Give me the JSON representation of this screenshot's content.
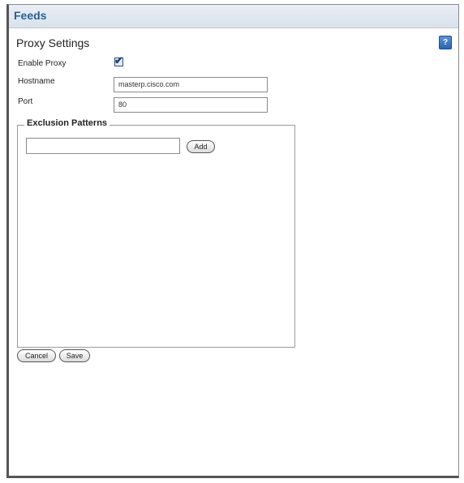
{
  "header": {
    "title": "Feeds"
  },
  "proxy": {
    "section_title": "Proxy Settings",
    "help_icon_label": "?",
    "enable_proxy_label": "Enable Proxy",
    "enable_proxy_checked": true,
    "hostname_label": "Hostname",
    "hostname_value": "masterp.cisco.com",
    "port_label": "Port",
    "port_value": "80"
  },
  "exclusion": {
    "legend": "Exclusion Patterns",
    "pattern_input_value": "",
    "add_label": "Add"
  },
  "actions": {
    "cancel_label": "Cancel",
    "save_label": "Save"
  },
  "colors": {
    "header_title": "#2c5f8f",
    "help_icon": "#2a64ad"
  }
}
